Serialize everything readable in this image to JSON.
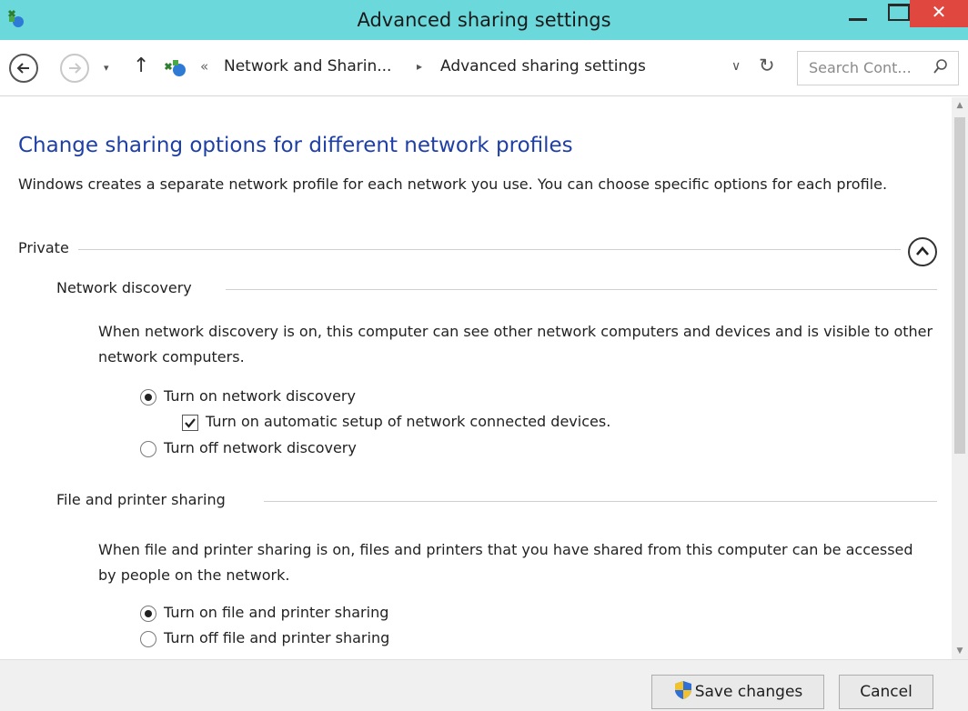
{
  "window": {
    "title": "Advanced sharing settings",
    "close_glyph": "✕"
  },
  "address": {
    "recent_glyph": "▾",
    "up_glyph": "↑",
    "overflow": "«",
    "crumbs": [
      "Network and Sharin...",
      "Advanced sharing settings"
    ],
    "crumb_arrow": "▸",
    "dropdown_glyph": "∨",
    "refresh_glyph": "↻",
    "search_placeholder": "Search Cont..."
  },
  "icons": {
    "app": "network-sharing-icon",
    "back": "back-arrow-icon",
    "forward": "forward-arrow-icon",
    "search": "search-icon",
    "collapse": "chevron-up-icon",
    "shield": "uac-shield-icon"
  },
  "content": {
    "heading": "Change sharing options for different network profiles",
    "intro": "Windows creates a separate network profile for each network you use. You can choose specific options for each profile.",
    "profile": "Private",
    "sections": [
      {
        "title": "Network discovery",
        "description": "When network discovery is on, this computer can see other network computers and devices and is visible to other network computers.",
        "options": [
          {
            "label": "Turn on network discovery",
            "selected": true
          },
          {
            "label": "Turn on automatic setup of network connected devices.",
            "checked": true
          },
          {
            "label": "Turn off network discovery",
            "selected": false
          }
        ]
      },
      {
        "title": "File and printer sharing",
        "description": "When file and printer sharing is on, files and printers that you have shared from this computer can be accessed by people on the network.",
        "options": [
          {
            "label": "Turn on file and printer sharing",
            "selected": true
          },
          {
            "label": "Turn off file and printer sharing",
            "selected": false
          }
        ]
      }
    ]
  },
  "footer": {
    "save_label": "Save changes",
    "cancel_label": "Cancel"
  },
  "colors": {
    "titlebar": "#6bd9dc",
    "heading": "#1e3fa6",
    "close": "#e0473f"
  }
}
